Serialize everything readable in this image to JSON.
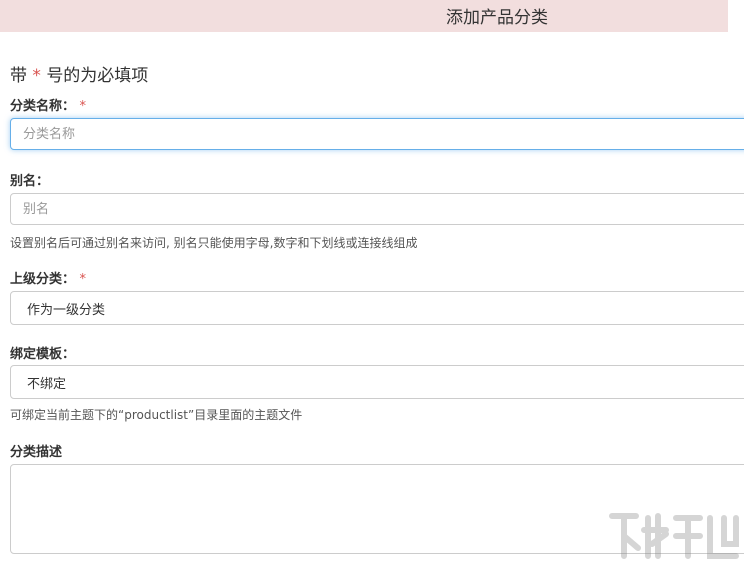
{
  "header": {
    "title": "添加产品分类"
  },
  "form": {
    "required_note_prefix": "带",
    "required_note_star": "*",
    "required_note_suffix": "号的为必填项",
    "name_field": {
      "label": "分类名称：",
      "required": "*",
      "placeholder": "分类名称",
      "value": ""
    },
    "alias_field": {
      "label": "别名：",
      "placeholder": "别名",
      "value": "",
      "help": "设置别名后可通过别名来访问, 别名只能使用字母,数字和下划线或连接线组成"
    },
    "parent_field": {
      "label": "上级分类：",
      "required": "*",
      "selected": "作为一级分类"
    },
    "template_field": {
      "label": "绑定模板：",
      "selected": "不绑定",
      "help": "可绑定当前主题下的“productlist”目录里面的主题文件"
    },
    "description_field": {
      "label": "分类描述",
      "value": ""
    }
  },
  "watermark": {
    "icon": "download-site-logo-icon"
  },
  "colors": {
    "header_bg": "#f2dede",
    "required_star": "#d9534f",
    "focus_border": "#66afe9"
  }
}
